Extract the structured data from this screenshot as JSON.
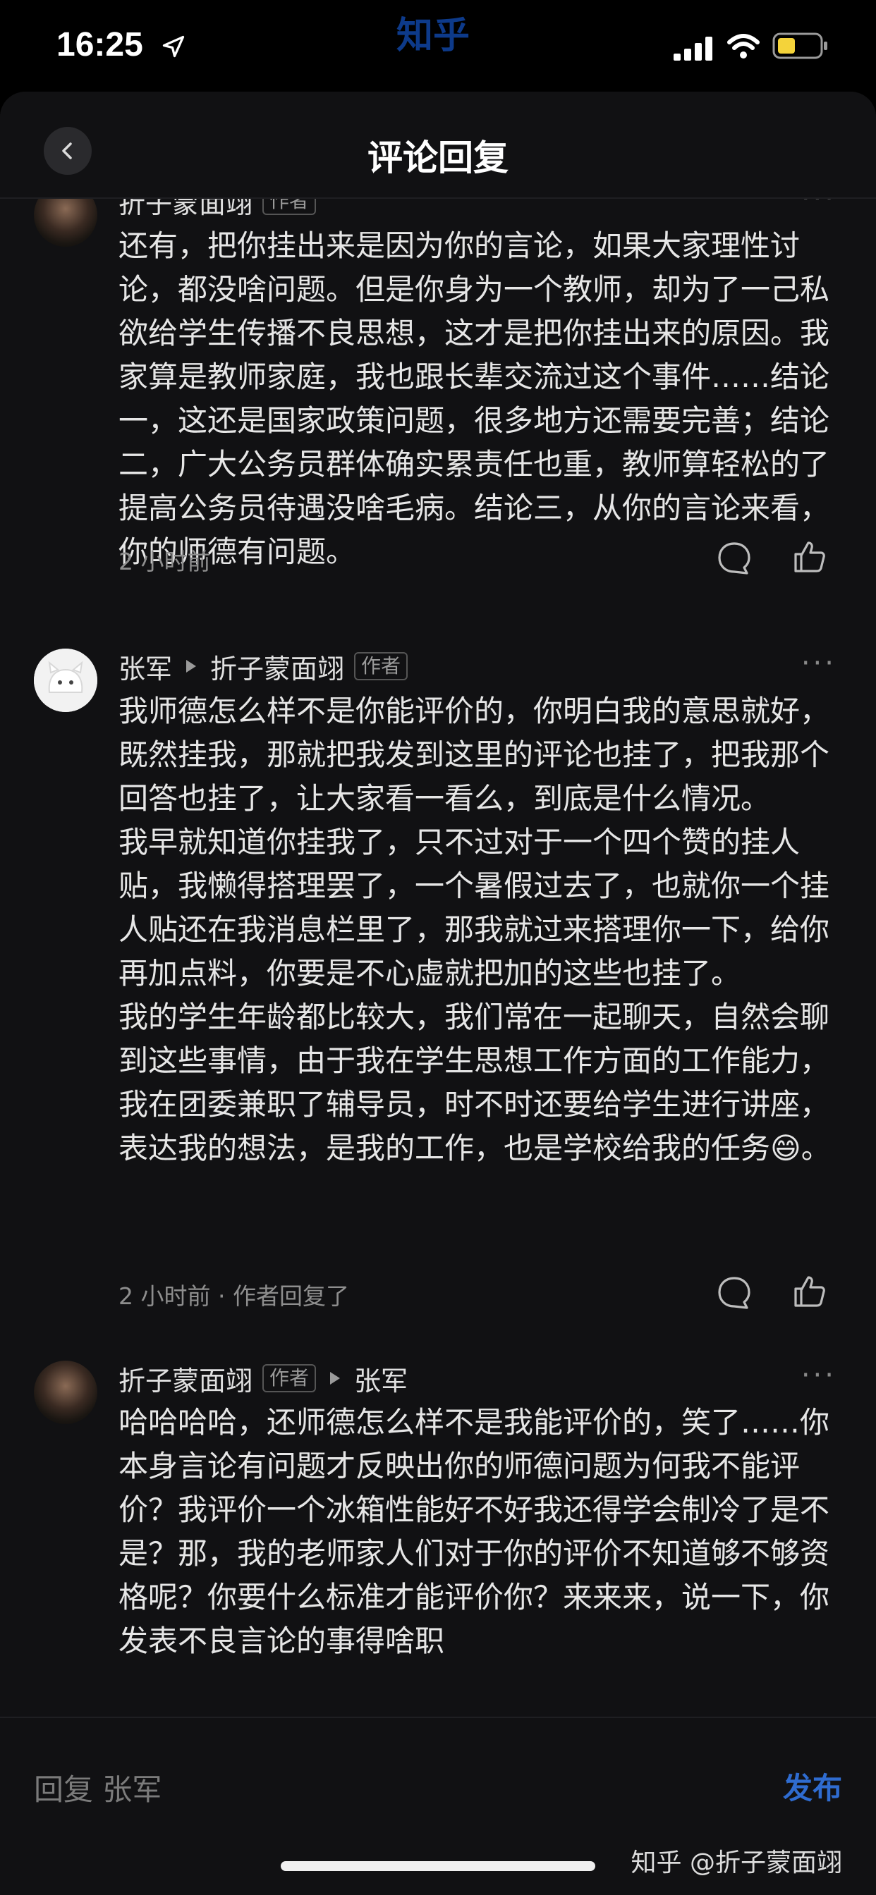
{
  "status_bar": {
    "time": "16:25",
    "watermark": "知乎"
  },
  "header": {
    "title": "评论回复"
  },
  "comments": [
    {
      "author": "折子蒙面翊",
      "badge": "作者",
      "text": "还有，把你挂出来是因为你的言论，如果大家理性讨论，都没啥问题。但是你身为一个教师，却为了一己私欲给学生传播不良思想，这才是把你挂出来的原因。我家算是教师家庭，我也跟长辈交流过这个事件……结论一，这还是国家政策问题，很多地方还需要完善；结论二，广大公务员群体确实累责任也重，教师算轻松的了提高公务员待遇没啥毛病。结论三，从你的言论来看，你的师德有问题。",
      "time": "2 小时前"
    },
    {
      "author": "张军",
      "reply_to": "折子蒙面翊",
      "reply_to_badge": "作者",
      "paragraphs": [
        "我师德怎么样不是你能评价的，你明白我的意思就好，既然挂我，那就把我发到这里的评论也挂了，把我那个回答也挂了，让大家看一看么，到底是什么情况。",
        "我早就知道你挂我了，只不过对于一个四个赞的挂人贴，我懒得搭理罢了，一个暑假过去了，也就你一个挂人贴还在我消息栏里了，那我就过来搭理你一下，给你再加点料，你要是不心虚就把加的这些也挂了。",
        "我的学生年龄都比较大，我们常在一起聊天，自然会聊到这些事情，由于我在学生思想工作方面的工作能力，我在团委兼职了辅导员，时不时还要给学生进行讲座，表达我的想法，是我的工作，也是学校给我的任务😄。"
      ],
      "time": "2 小时前",
      "status": "作者回复了"
    },
    {
      "author": "折子蒙面翊",
      "badge": "作者",
      "reply_to": "张军",
      "text": "哈哈哈哈，还师德怎么样不是我能评价的，笑了……你本身言论有问题才反映出你的师德问题为何我不能评价？我评价一个冰箱性能好不好我还得学会制冷了是不是？那，我的老师家人们对于你的评价不知道够不够资格呢？你要什么标准才能评价你？来来来，说一下，你发表不良言论的事得啥职"
    }
  ],
  "footer": {
    "reply_placeholder": "回复 张军",
    "publish_label": "发布",
    "watermark": "知乎 @折子蒙面翊"
  },
  "colors": {
    "accent": "#2f6cd0",
    "background": "#111113",
    "text": "#e6e6e6",
    "muted": "#8e8e8e"
  },
  "icons": [
    "back-arrow-icon",
    "more-icon",
    "comment-bubble-icon",
    "thumbs-up-icon",
    "location-arrow-icon",
    "signal-icon",
    "wifi-icon",
    "battery-icon"
  ]
}
